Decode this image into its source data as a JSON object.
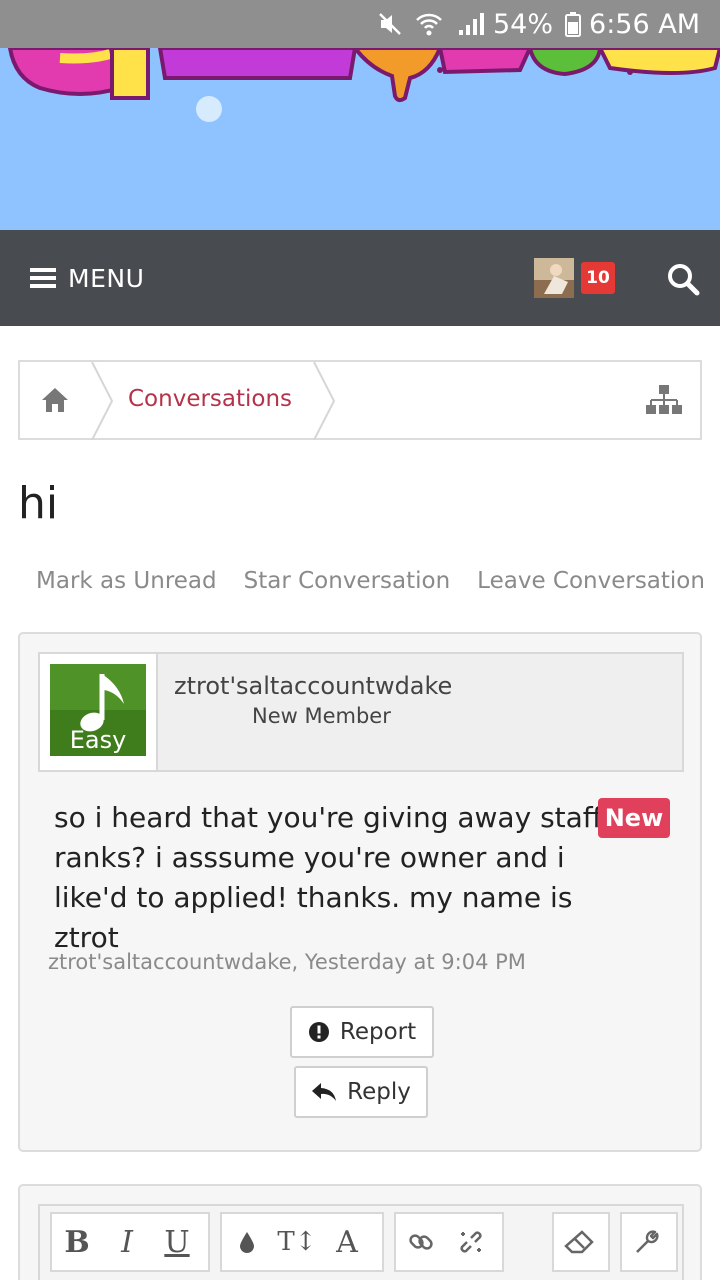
{
  "status_bar": {
    "battery": "54%",
    "time": "6:56 AM"
  },
  "nav": {
    "menu_label": "MENU",
    "notification_count": "10"
  },
  "breadcrumb": {
    "link_label": "Conversations"
  },
  "page": {
    "title": "hi"
  },
  "actions": [
    "Mark as Unread",
    "Star Conversation",
    "Leave Conversation"
  ],
  "message": {
    "avatar_text": "Easy",
    "username": "ztrot'saltaccountwdake",
    "user_title": "New Member",
    "body": "so i heard that you're giving away staff ranks? i asssume you're owner and i like'd to applied! thanks. my name is ztrot",
    "new_label": "New",
    "meta": "ztrot'saltaccountwdake, Yesterday at 9:04 PM",
    "report_label": "Report",
    "reply_label": "Reply"
  },
  "editor": {
    "bold": "B",
    "italic": "I",
    "underline": "U",
    "text_size": "T↕",
    "font": "A"
  },
  "colors": {
    "nav_bg": "#484c50",
    "banner_bg": "#8fc3ff",
    "accent_link": "#b5334a",
    "badge_red": "#e53935",
    "new_badge": "#e0405b"
  }
}
